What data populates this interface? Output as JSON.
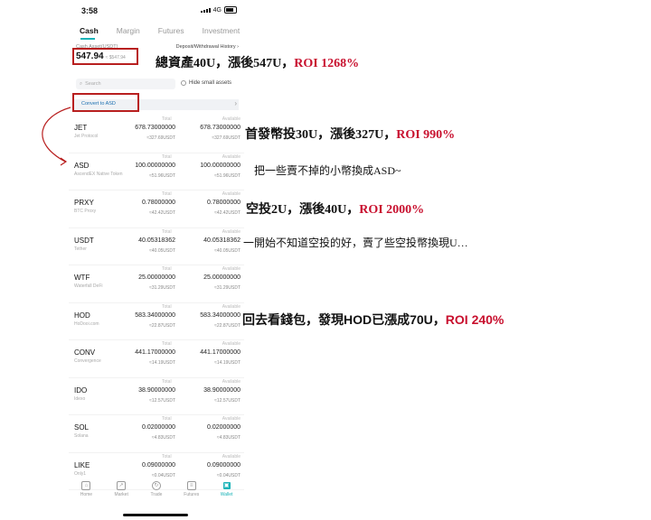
{
  "status_bar": {
    "time": "3:58",
    "network": "4G"
  },
  "tabs": [
    {
      "label": "Cash"
    },
    {
      "label": "Margin"
    },
    {
      "label": "Futures"
    },
    {
      "label": "Investment"
    }
  ],
  "summary": {
    "cash_label": "Cash Asset(USDT)",
    "deposit_link": "Deposit/Withdrawal History",
    "total": "547.94",
    "total_sub": "≈ $547.94"
  },
  "search": {
    "placeholder": "Search",
    "hide_small": "Hide small assets"
  },
  "convert": {
    "label": "Convert to ASD"
  },
  "assets": [
    {
      "symbol": "JET",
      "name": "Jet Protocol",
      "total_h": "Total",
      "total": "678.73000000",
      "total_usd": "≈327.69USDT",
      "avail_h": "Available",
      "avail": "678.73000000",
      "avail_usd": "≈327.69USDT"
    },
    {
      "symbol": "ASD",
      "name": "AscendEX Native Token",
      "total_h": "Total",
      "total": "100.00000000",
      "total_usd": "≈51.96USDT",
      "avail_h": "Available",
      "avail": "100.00000000",
      "avail_usd": "≈51.96USDT"
    },
    {
      "symbol": "PRXY",
      "name": "BTC Proxy",
      "total_h": "Total",
      "total": "0.78000000",
      "total_usd": "≈42.42USDT",
      "avail_h": "Available",
      "avail": "0.78000000",
      "avail_usd": "≈42.42USDT"
    },
    {
      "symbol": "USDT",
      "name": "Tether",
      "total_h": "Total",
      "total": "40.05318362",
      "total_usd": "≈40.05USDT",
      "avail_h": "Available",
      "avail": "40.05318362",
      "avail_usd": "≈40.05USDT"
    },
    {
      "symbol": "WTF",
      "name": "Waterfall DeFi",
      "total_h": "Total",
      "total": "25.00000000",
      "total_usd": "≈31.29USDT",
      "avail_h": "Available",
      "avail": "25.00000000",
      "avail_usd": "≈31.29USDT"
    },
    {
      "symbol": "HOD",
      "name": "HoDooi.com",
      "total_h": "Total",
      "total": "583.34000000",
      "total_usd": "≈22.87USDT",
      "avail_h": "Available",
      "avail": "583.34000000",
      "avail_usd": "≈22.87USDT"
    },
    {
      "symbol": "CONV",
      "name": "Convergence",
      "total_h": "Total",
      "total": "441.17000000",
      "total_usd": "≈14.19USDT",
      "avail_h": "Available",
      "avail": "441.17000000",
      "avail_usd": "≈14.19USDT"
    },
    {
      "symbol": "IDO",
      "name": "Idexo",
      "total_h": "Total",
      "total": "38.90000000",
      "total_usd": "≈12.57USDT",
      "avail_h": "Available",
      "avail": "38.90000000",
      "avail_usd": "≈12.57USDT"
    },
    {
      "symbol": "SOL",
      "name": "Solana",
      "total_h": "Total",
      "total": "0.02000000",
      "total_usd": "≈4.83USDT",
      "avail_h": "Available",
      "avail": "0.02000000",
      "avail_usd": "≈4.83USDT"
    },
    {
      "symbol": "LIKE",
      "name": "Only1",
      "total_h": "Total",
      "total": "0.09000000",
      "total_usd": "≈0.04USDT",
      "avail_h": "Available",
      "avail": "0.09000000",
      "avail_usd": "≈0.04USDT"
    }
  ],
  "nav": [
    {
      "label": "Home",
      "icon": "home-icon"
    },
    {
      "label": "Market",
      "icon": "market-icon"
    },
    {
      "label": "Trade",
      "icon": "trade-icon"
    },
    {
      "label": "Futures",
      "icon": "futures-icon"
    },
    {
      "label": "Wallet",
      "icon": "wallet-icon"
    }
  ],
  "annotations": {
    "n1_text": "總資產40U，漲後547U，",
    "n1_roi": "ROI 1268%",
    "n2_text": "首發幣投30U，漲後327U，",
    "n2_roi": "ROI 990%",
    "n3_text": "把一些賣不掉的小幣換成ASD~",
    "n4_text": "空投2U，漲後40U，",
    "n4_roi": "ROI 2000%",
    "n5_text": "一開始不知道空投的好，賣了些空投幣換現U…",
    "n6_text": "回去看錢包，發現HOD已漲成70U，",
    "n6_roi": "ROI 240%"
  },
  "colors": {
    "accent": "#1ab3b8",
    "highlight_red": "#b81f1f",
    "roi_red": "#c8102e"
  }
}
